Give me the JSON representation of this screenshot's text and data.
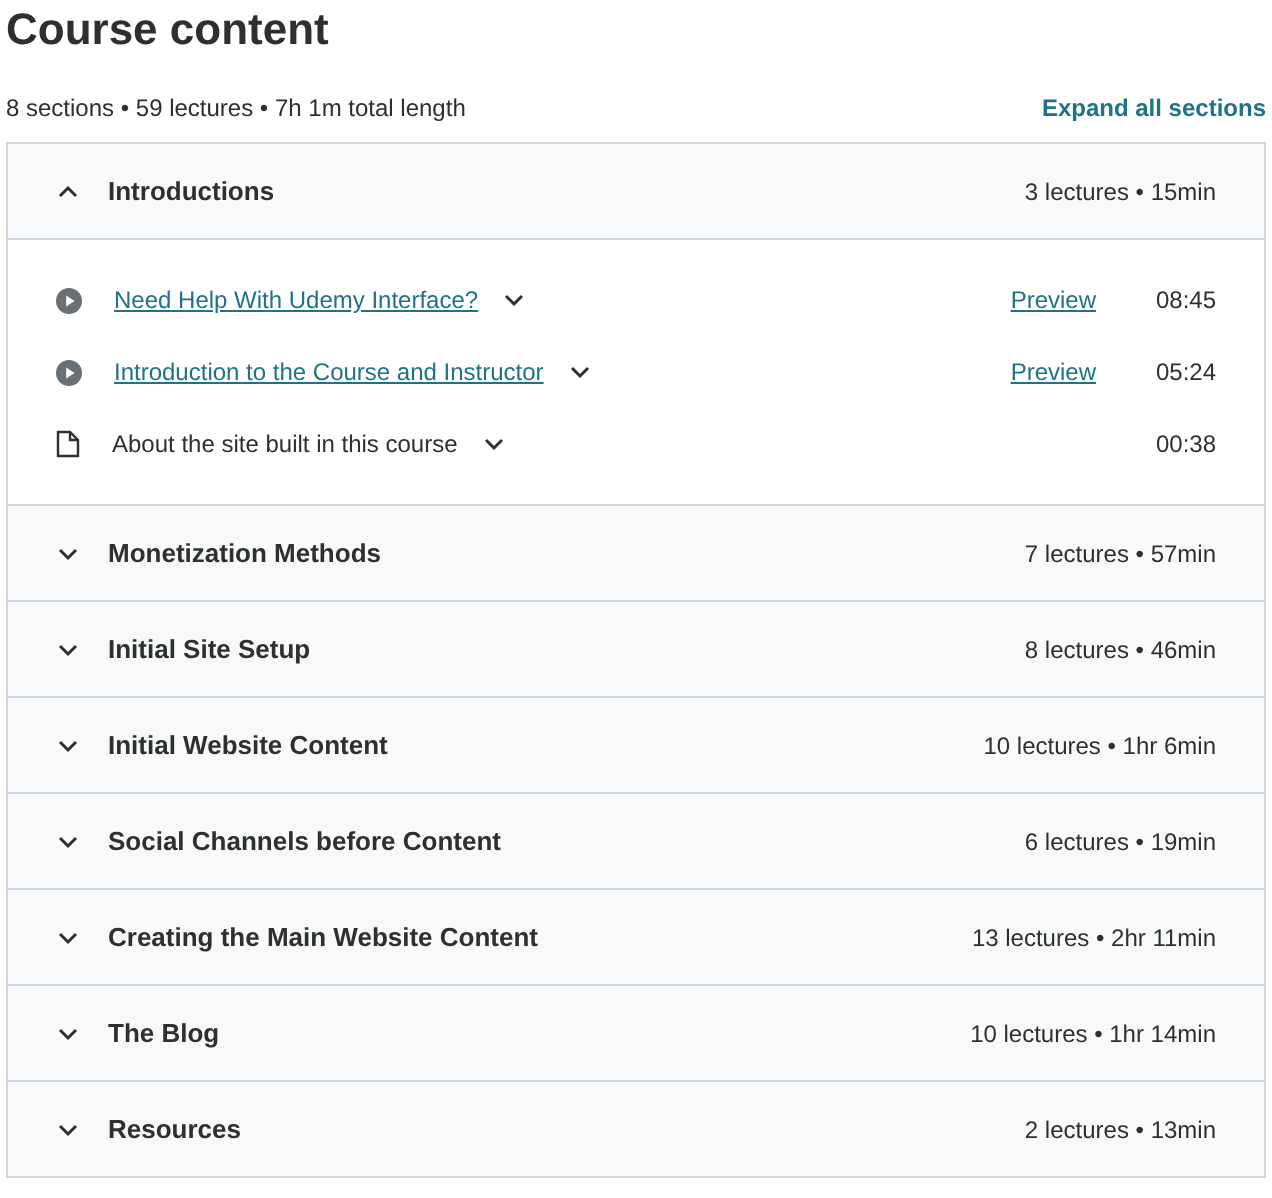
{
  "title": "Course content",
  "summary": "8 sections • 59 lectures • 7h 1m total length",
  "expand_all": "Expand all sections",
  "sections": [
    {
      "title": "Introductions",
      "meta": "3 lectures • 15min",
      "expanded": true,
      "lectures": [
        {
          "kind": "video",
          "title": "Need Help With Udemy Interface?",
          "preview": "Preview",
          "duration": "08:45"
        },
        {
          "kind": "video",
          "title": "Introduction to the Course and Instructor",
          "preview": "Preview",
          "duration": "05:24"
        },
        {
          "kind": "article",
          "title": "About the site built in this course",
          "duration": "00:38"
        }
      ]
    },
    {
      "title": "Monetization Methods",
      "meta": "7 lectures • 57min",
      "expanded": false
    },
    {
      "title": "Initial Site Setup",
      "meta": "8 lectures • 46min",
      "expanded": false
    },
    {
      "title": "Initial Website Content",
      "meta": "10 lectures • 1hr 6min",
      "expanded": false
    },
    {
      "title": "Social Channels before Content",
      "meta": "6 lectures • 19min",
      "expanded": false
    },
    {
      "title": "Creating the Main Website Content",
      "meta": "13 lectures • 2hr 11min",
      "expanded": false
    },
    {
      "title": "The Blog",
      "meta": "10 lectures • 1hr 14min",
      "expanded": false
    },
    {
      "title": "Resources",
      "meta": "2 lectures • 13min",
      "expanded": false
    }
  ]
}
